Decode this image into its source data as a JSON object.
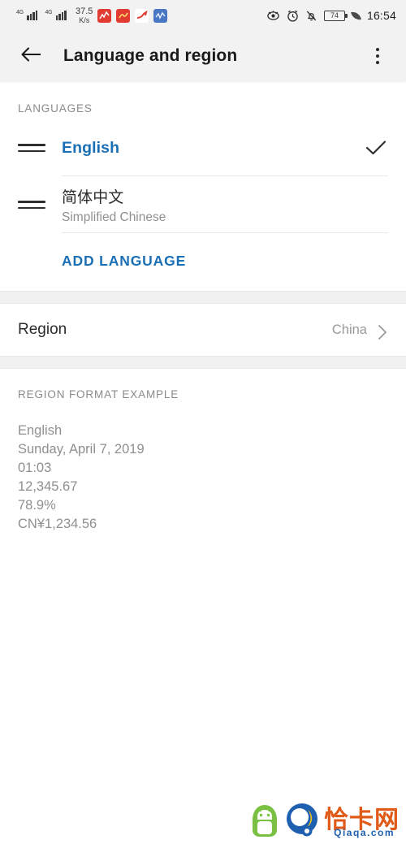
{
  "status_bar": {
    "network_type_1": "4G",
    "network_type_2": "4G",
    "net_speed_value": "37.5",
    "net_speed_unit": "K/s",
    "app_icon_1": "stock-chart-icon",
    "app_icon_2": "stock-alert-icon",
    "app_icon_3": "trend-arrow-icon",
    "app_icon_4": "market-wave-icon",
    "eye_comfort_icon": "eye-icon",
    "alarm_icon": "alarm-clock-icon",
    "silent_icon": "bell-muted-icon",
    "battery_percent": "74",
    "power_saving_icon": "leaf-icon",
    "clock": "16:54"
  },
  "appbar": {
    "back_icon": "arrow-left-icon",
    "title": "Language and region",
    "overflow_icon": "more-vertical-icon"
  },
  "languages_section": {
    "header": "LANGUAGES",
    "items": [
      {
        "drag_icon": "drag-handle-icon",
        "primary": "English",
        "secondary": "",
        "selected": true,
        "check_icon": "check-icon"
      },
      {
        "drag_icon": "drag-handle-icon",
        "primary": "简体中文",
        "secondary": "Simplified Chinese",
        "selected": false,
        "check_icon": ""
      }
    ],
    "add_language_label": "ADD LANGUAGE"
  },
  "region_section": {
    "label": "Region",
    "value": "China",
    "chevron_icon": "chevron-right-icon"
  },
  "format_section": {
    "header": "REGION FORMAT EXAMPLE",
    "lines": [
      "English",
      "Sunday, April 7, 2019",
      "01:03",
      "12,345.67",
      "78.9%",
      "CN¥1,234.56"
    ]
  },
  "watermark": {
    "android_icon": "android-robot-icon",
    "q_logo_icon": "q-circle-logo-icon",
    "site_name_cn": "恰卡网",
    "site_url": "Qiaqa.com"
  },
  "colors": {
    "accent_blue": "#1a6fb5",
    "statusbar_bg": "#f2f2f2",
    "page_bg": "#ffffff",
    "muted_text": "#8f8f8f",
    "watermark_orange": "#e05a18",
    "watermark_blue": "#1f5fb0"
  }
}
